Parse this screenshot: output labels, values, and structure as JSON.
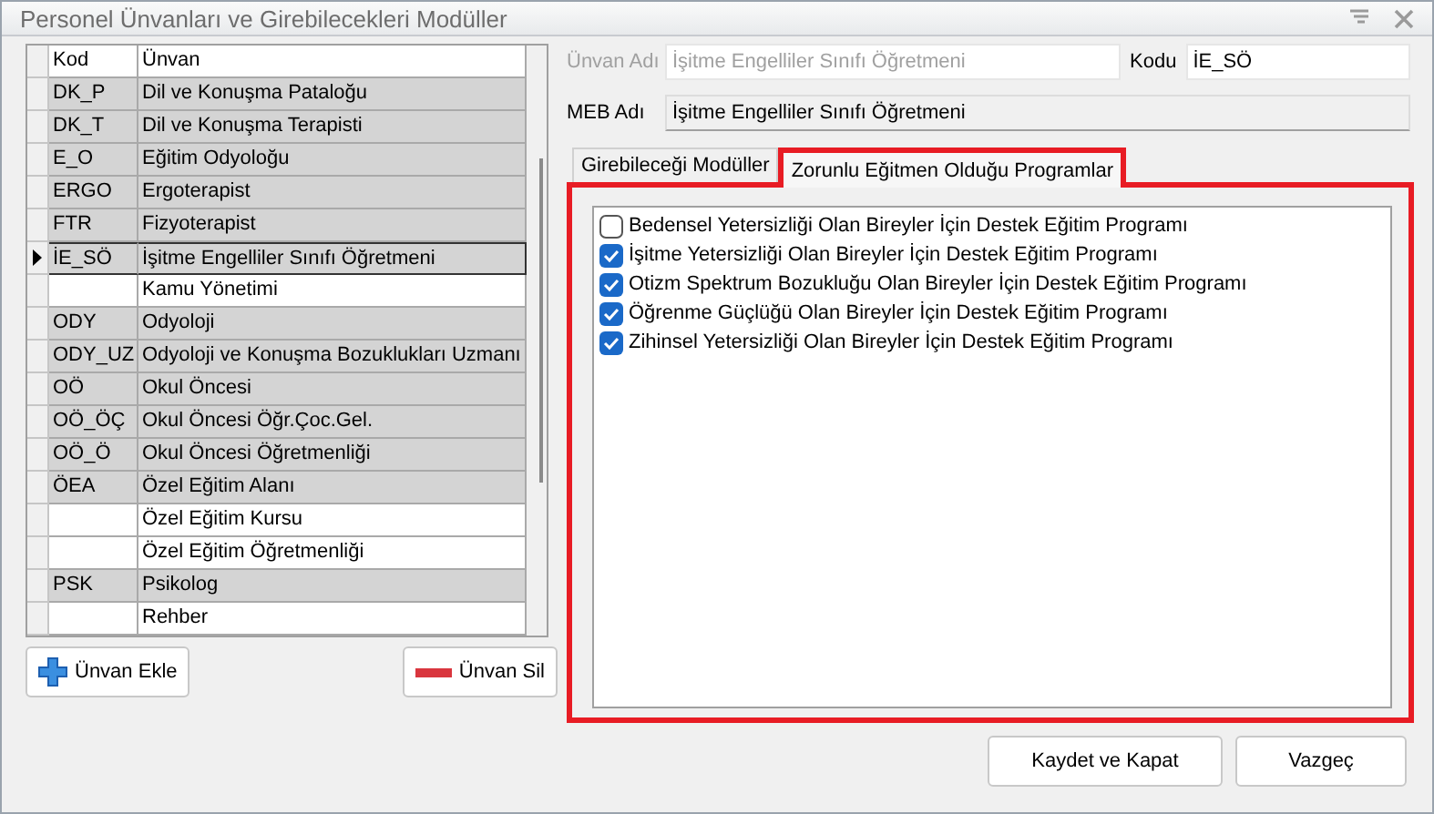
{
  "window": {
    "title": "Personel Ünvanları ve Girebilecekleri Modüller"
  },
  "table": {
    "columns": [
      "Kod",
      "Ünvan"
    ],
    "rows": [
      {
        "code": "DK_P",
        "title": "Dil ve Konuşma Pataloğu",
        "selected": false
      },
      {
        "code": "DK_T",
        "title": "Dil ve Konuşma Terapisti",
        "selected": false
      },
      {
        "code": "E_O",
        "title": "Eğitim Odyoloğu",
        "selected": false
      },
      {
        "code": "ERGO",
        "title": "Ergoterapist",
        "selected": false
      },
      {
        "code": "FTR",
        "title": "Fizyoterapist",
        "selected": false
      },
      {
        "code": "İE_SÖ",
        "title": "İşitme Engelliler Sınıfı Öğretmeni",
        "selected": true
      },
      {
        "title": "Kamu Yönetimi",
        "selected": false
      },
      {
        "code": "ODY",
        "title": "Odyoloji",
        "selected": false
      },
      {
        "code": "ODY_UZ",
        "title": "Odyoloji ve Konuşma Bozuklukları Uzmanı",
        "selected": false
      },
      {
        "code": "OÖ",
        "title": "Okul Öncesi",
        "selected": false
      },
      {
        "code": "OÖ_ÖÇ",
        "title": "Okul Öncesi Öğr.Çoc.Gel.",
        "selected": false
      },
      {
        "code": "OÖ_Ö",
        "title": "Okul Öncesi Öğretmenliği",
        "selected": false
      },
      {
        "code": "ÖEA",
        "title": "Özel Eğitim Alanı",
        "selected": false
      },
      {
        "title": "Özel Eğitim Kursu",
        "selected": false
      },
      {
        "title": "Özel Eğitim Öğretmenliği",
        "selected": false
      },
      {
        "code": "PSK",
        "title": "Psikolog",
        "selected": false
      },
      {
        "title": "Rehber",
        "selected": false
      }
    ]
  },
  "left_buttons": [
    {
      "kind": "add",
      "label": "Ünvan Ekle"
    },
    {
      "kind": "remove",
      "label": "Ünvan Sil"
    }
  ],
  "fields": [
    {
      "label": "Ünvan Adı",
      "value": "İşitme Engelliler Sınıfı Öğretmeni",
      "disabled": true,
      "readonly": false
    },
    {
      "label": "Kodu",
      "value": "İE_SÖ",
      "disabled": false,
      "readonly": false
    },
    {
      "label": "MEB Adı",
      "value": "İşitme Engelliler Sınıfı Öğretmeni",
      "disabled": false,
      "readonly": true
    }
  ],
  "tabs": [
    {
      "label": "Girebileceği Modüller",
      "selected": false
    },
    {
      "label": "Zorunlu Eğitmen Olduğu Programlar",
      "selected": true
    }
  ],
  "tab_panel": {
    "highlighted": true,
    "programs": [
      {
        "label": "Bedensel Yetersizliği Olan Bireyler İçin Destek Eğitim Programı",
        "checked": false
      },
      {
        "label": "İşitme Yetersizliği Olan Bireyler İçin Destek Eğitim Programı",
        "checked": true
      },
      {
        "label": "Otizm Spektrum Bozukluğu Olan Bireyler İçin Destek Eğitim Programı",
        "checked": true
      },
      {
        "label": "Öğrenme Güçlüğü Olan Bireyler İçin Destek Eğitim Programı",
        "checked": true
      },
      {
        "label": "Zihinsel Yetersizliği Olan Bireyler İçin Destek Eğitim Programı",
        "checked": true
      }
    ]
  },
  "footer_buttons": [
    "Kaydet ve Kapat",
    "Vazgeç"
  ]
}
